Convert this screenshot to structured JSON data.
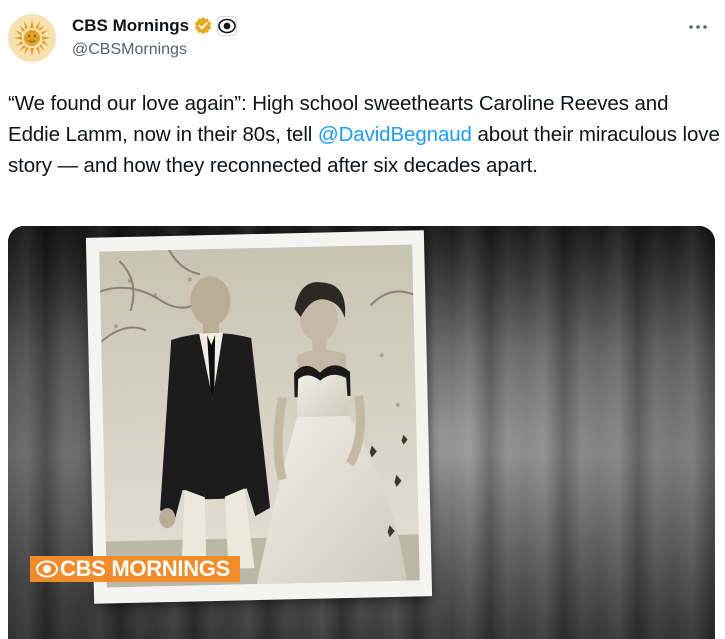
{
  "account": {
    "display_name": "CBS Mornings",
    "handle": "@CBSMornings",
    "avatar_icon": "sun-logo-icon",
    "verified_icon": "verified-badge-icon",
    "affiliate_icon": "cbs-eye-icon"
  },
  "tweet": {
    "text_before": "“We found our love again”: High school sweethearts Caroline Reeves and Eddie Lamm, now in their 80s, tell ",
    "mention": "@DavidBegnaud",
    "text_after": " about their miraculous love story — and how they reconnected after six decades apart."
  },
  "media": {
    "logo_text": "CBS MORNINGS",
    "logo_color": "#f28c2a"
  },
  "colors": {
    "link": "#1d9bf0",
    "text": "#0f1419",
    "secondary": "#536471",
    "verified": "#e8a923"
  }
}
